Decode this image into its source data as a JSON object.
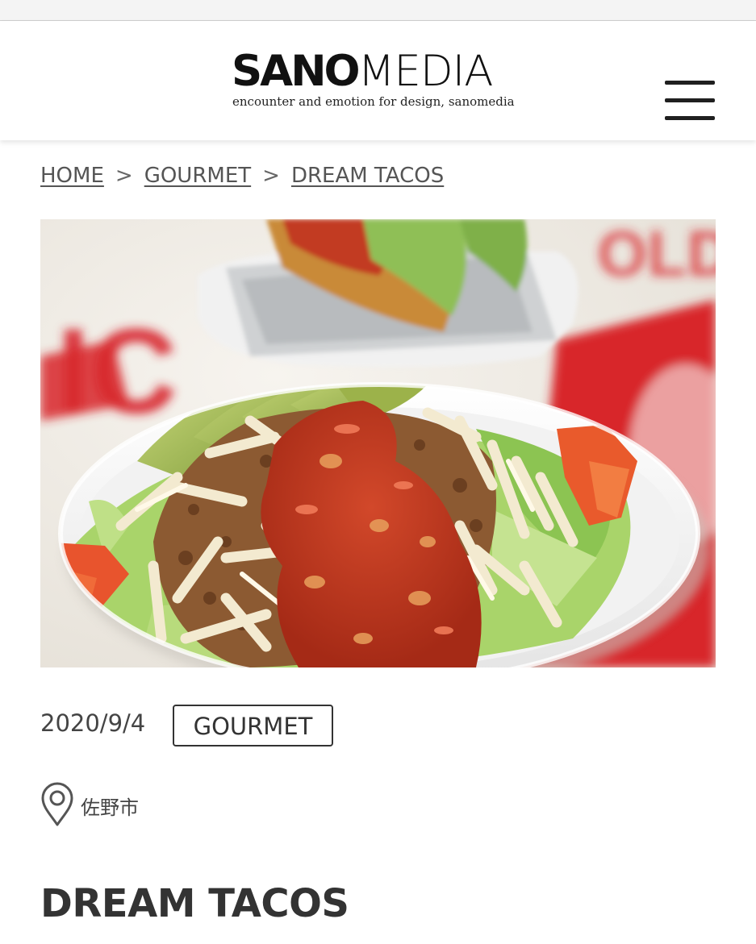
{
  "header": {
    "logo_bold": "SANO",
    "logo_light": "MEDIA",
    "tagline": "encounter and emotion for design, sanomedia"
  },
  "breadcrumb": {
    "items": [
      "HOME",
      "GOURMET",
      "DREAM TACOS"
    ],
    "separator": ">"
  },
  "article": {
    "date": "2020/9/4",
    "category": "GOURMET",
    "location": "佐野市",
    "title": "DREAM TACOS"
  },
  "icons": {
    "menu": "hamburger-menu-icon",
    "location": "map-pin-icon"
  },
  "colors": {
    "text": "#333333",
    "accent_red": "#d8262c",
    "background": "#ffffff"
  }
}
